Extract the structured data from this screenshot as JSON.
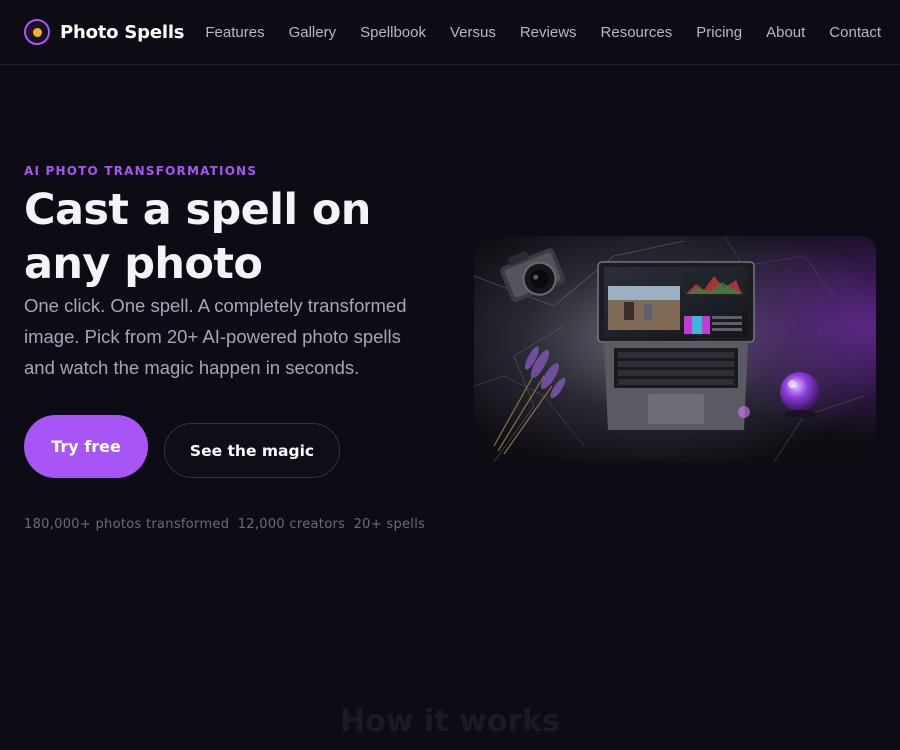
{
  "brand": {
    "name": "Photo Spells",
    "accent": "#a855f7",
    "logo_dot_color": "#f5b21a",
    "logo_icon": "orb-icon"
  },
  "nav": {
    "links": [
      "Features",
      "Gallery",
      "Spellbook",
      "Versus",
      "Reviews",
      "Resources",
      "Pricing",
      "About",
      "Contact"
    ]
  },
  "hero": {
    "eyebrow": "AI PHOTO TRANSFORMATIONS",
    "title": "Cast a spell on any photo",
    "subtitle": "One click. One spell. A completely transformed image. Pick from 20+ AI-powered photo spells and watch the magic happen in seconds.",
    "primary_cta": "Try free",
    "secondary_cta": "See the magic",
    "stats": [
      "180,000+ photos transformed",
      "12,000 creators",
      "20+ spells"
    ],
    "image": "laptop-with-camera-lavender-crystal-ball-photo"
  },
  "next_section": {
    "title": "How it works"
  },
  "colors": {
    "background": "#0d0c14",
    "text": "#f4f3f8",
    "muted": "#a8a5ba"
  }
}
